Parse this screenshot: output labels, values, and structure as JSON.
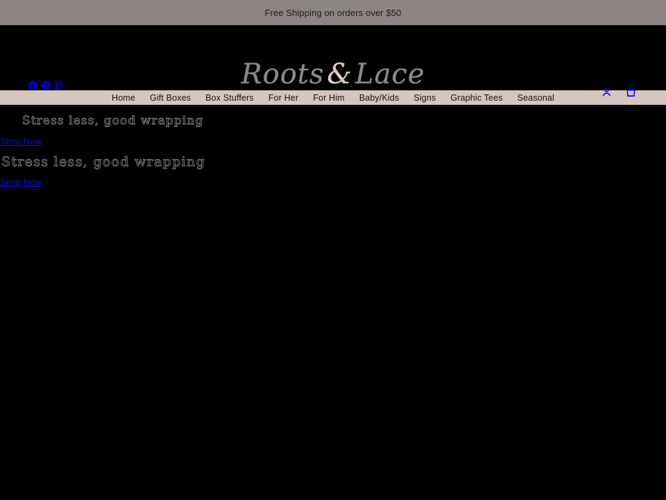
{
  "announcement": {
    "text": "Free Shipping on orders over $50"
  },
  "header": {
    "logo": {
      "left_text": "Roots",
      "ampersand": "&",
      "right_text": "Lace",
      "full_text": "Roots & Lace",
      "script_color": "#8b8a8a",
      "ampersand_color": "#e3c9c3"
    },
    "social": [
      {
        "name": "facebook-icon",
        "label": "Facebook"
      },
      {
        "name": "pinterest-icon",
        "label": "Pinterest"
      },
      {
        "name": "instagram-icon",
        "label": "Instagram"
      }
    ],
    "icons": [
      {
        "name": "account-icon",
        "label": "Account"
      },
      {
        "name": "cart-icon",
        "label": "Cart"
      }
    ],
    "icon_color": "#0000f0"
  },
  "nav": {
    "background": "#d6c5c1",
    "items": [
      {
        "label": "Home"
      },
      {
        "label": "Gift Boxes"
      },
      {
        "label": "Box Stuffers"
      },
      {
        "label": "For Her"
      },
      {
        "label": "For Him"
      },
      {
        "label": "Baby/Kids"
      },
      {
        "label": "Signs"
      },
      {
        "label": "Graphic Tees"
      },
      {
        "label": "Seasonal"
      }
    ]
  },
  "hero": {
    "slides": [
      {
        "heading": "Stress less, good wrapping",
        "link_label": "Shop Now"
      },
      {
        "heading": "Stress less, good wrapping",
        "link_label": "Shop Now"
      }
    ],
    "link_color": "#1414ff",
    "background": "#000000"
  }
}
